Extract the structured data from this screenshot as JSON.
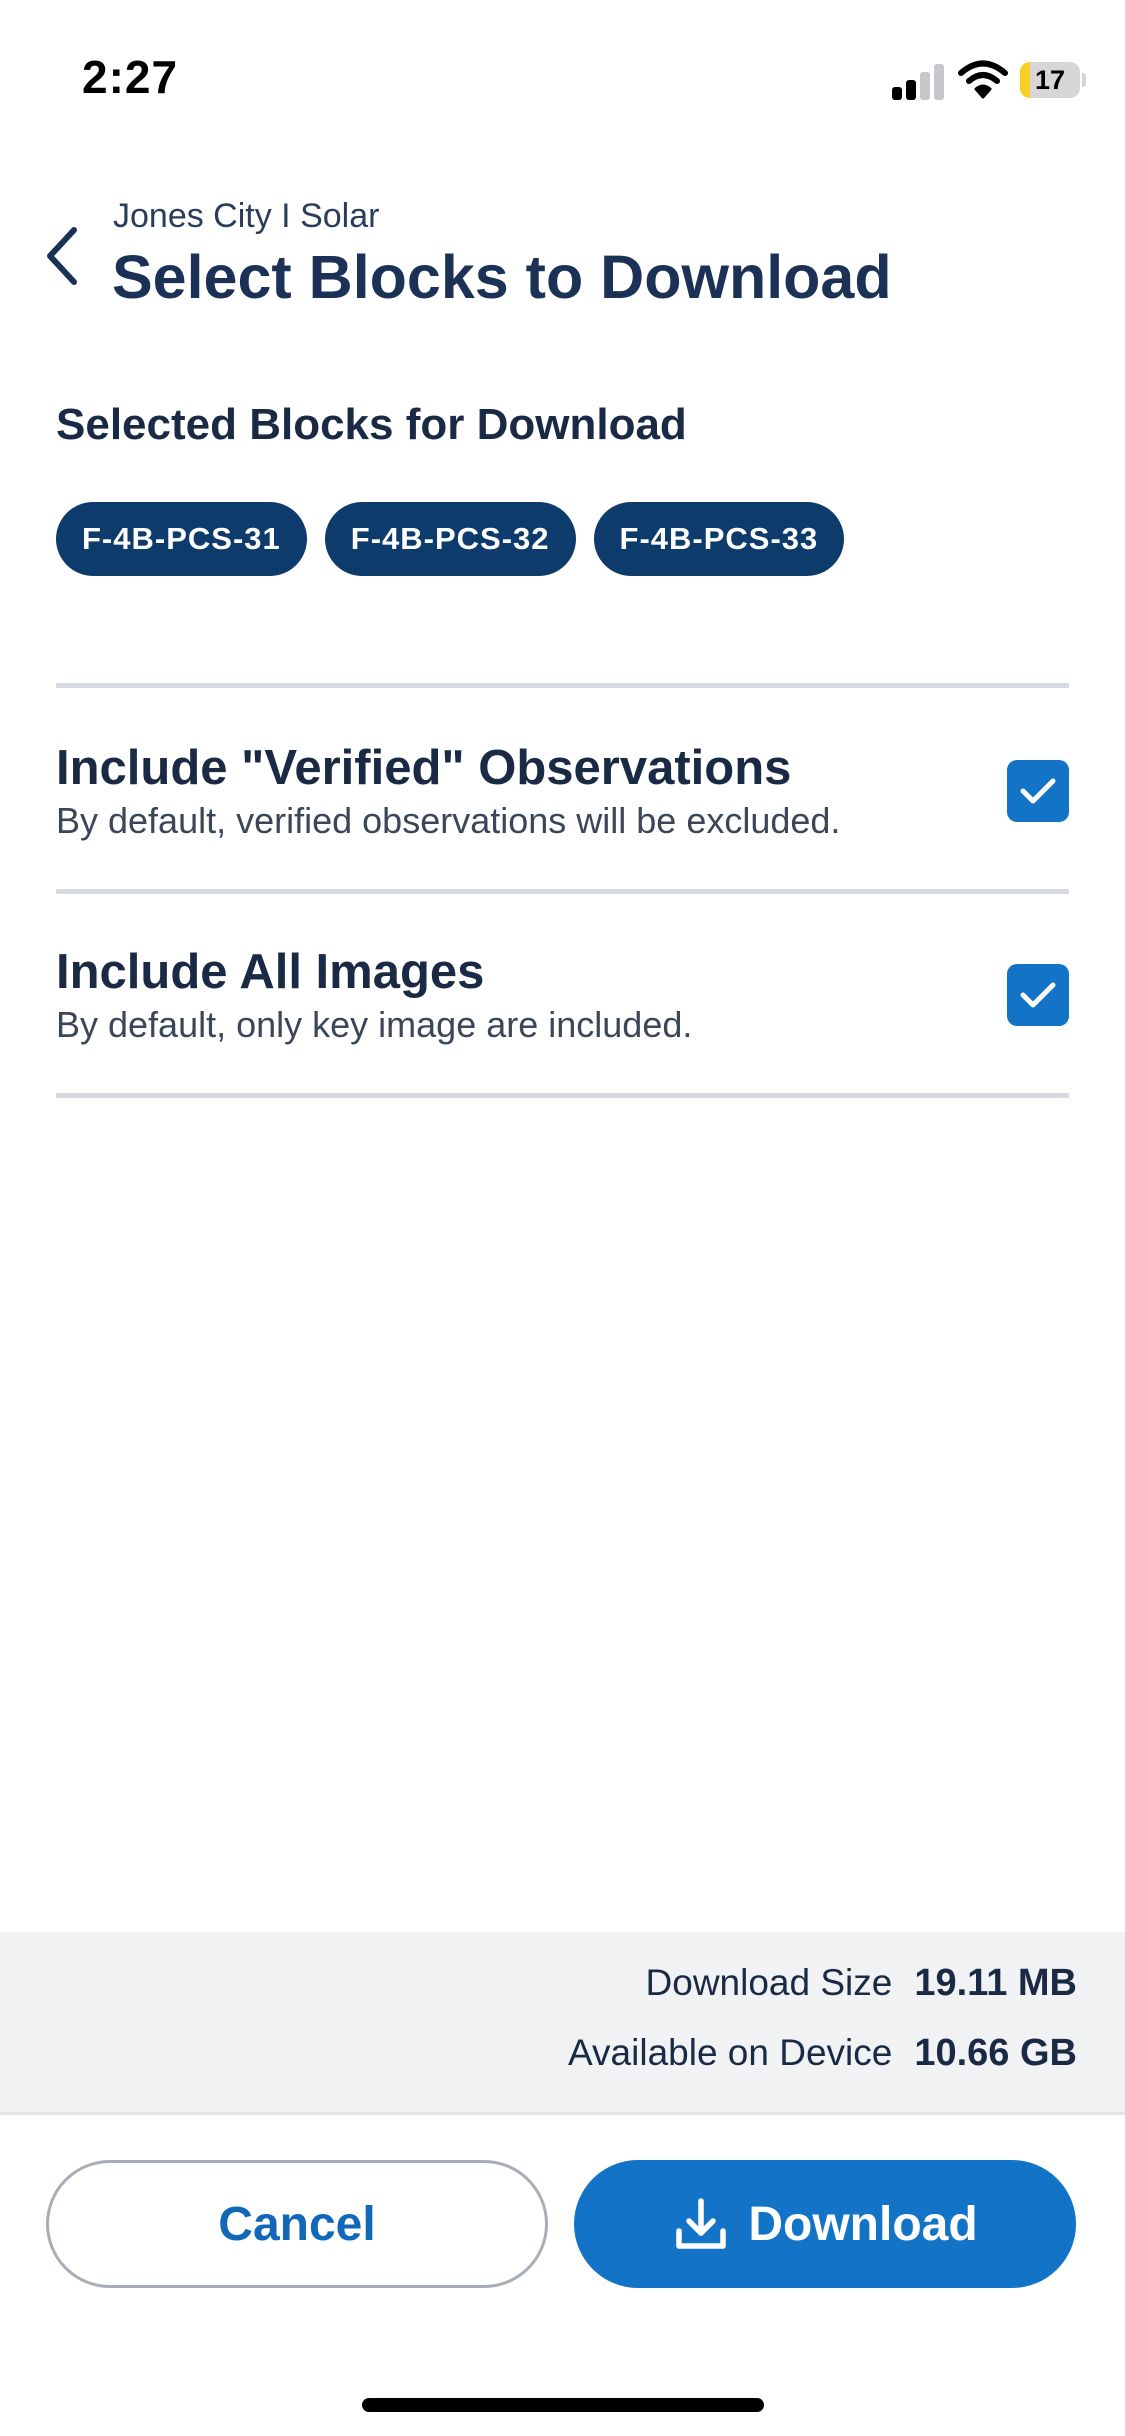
{
  "status_bar": {
    "time": "2:27",
    "battery_level": "17",
    "battery_fraction": 0.17,
    "signal_bars_active": 2,
    "signal_bars_total": 4
  },
  "header": {
    "breadcrumb": "Jones City I Solar",
    "title": "Select Blocks to Download",
    "back_icon": "chevron-left-icon"
  },
  "selected_blocks": {
    "heading": "Selected Blocks for Download",
    "chips": [
      "F-4B-PCS-31",
      "F-4B-PCS-32",
      "F-4B-PCS-33"
    ]
  },
  "options": [
    {
      "title": "Include \"Verified\" Observations",
      "description": "By default, verified observations will be excluded.",
      "checked": true
    },
    {
      "title": "Include All Images",
      "description": "By default, only key image are included.",
      "checked": true
    }
  ],
  "summary": {
    "download_size_label": "Download Size",
    "download_size_value": "19.11 MB",
    "available_label": "Available on Device",
    "available_value": "10.66 GB"
  },
  "actions": {
    "cancel_label": "Cancel",
    "download_label": "Download",
    "download_icon": "download-icon"
  },
  "colors": {
    "primary": "#1273c7",
    "chip": "#0d3b6b",
    "title": "#1b3155",
    "battery": "#f6cf22"
  }
}
